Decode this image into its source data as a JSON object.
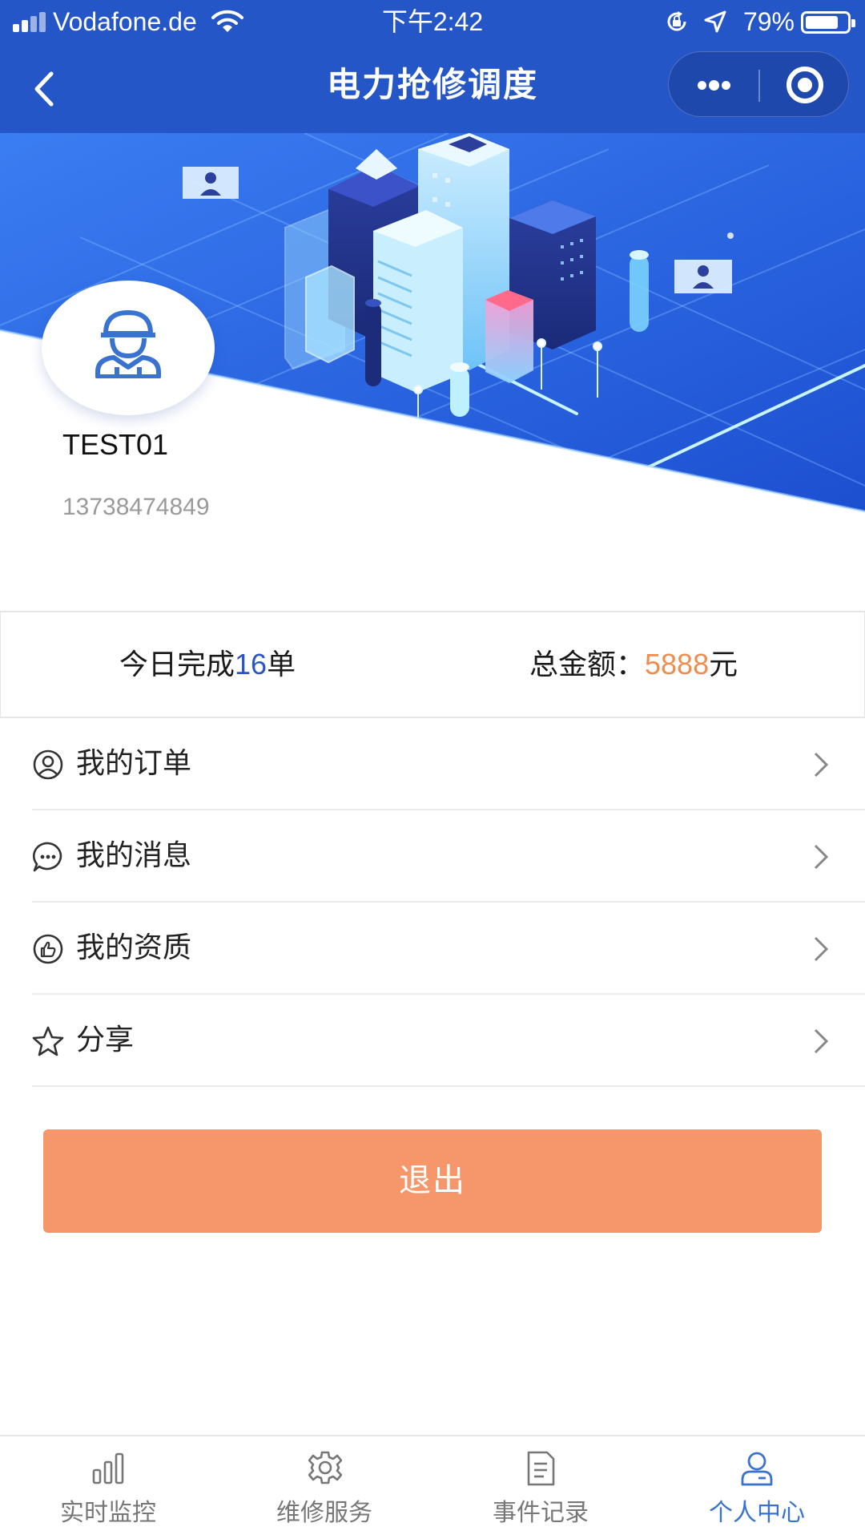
{
  "status_bar": {
    "carrier": "Vodafone.de",
    "time": "下午2:42",
    "battery_percent": "79%",
    "battery_level": 0.79
  },
  "nav": {
    "title": "电力抢修调度",
    "back_icon": "chevron-left-icon",
    "more_icon": "more-dots-icon",
    "close_icon": "target-circle-icon"
  },
  "profile": {
    "avatar_icon": "worker-helmet-icon",
    "name": "TEST01",
    "phone": "13738474849"
  },
  "stats": {
    "today_prefix": "今日完成",
    "today_count": "16",
    "today_suffix": "单",
    "total_prefix": "总金额：",
    "total_amount": "5888",
    "total_suffix": "元"
  },
  "menu": {
    "items": [
      {
        "label": "我的订单",
        "icon": "user-circle-icon"
      },
      {
        "label": "我的消息",
        "icon": "chat-bubble-icon"
      },
      {
        "label": "我的资质",
        "icon": "thumbs-up-icon"
      },
      {
        "label": "分享",
        "icon": "star-icon"
      }
    ]
  },
  "logout_label": "退出",
  "tabs": [
    {
      "label": "实时监控",
      "icon": "bar-chart-icon",
      "active": false
    },
    {
      "label": "维修服务",
      "icon": "gear-icon",
      "active": false
    },
    {
      "label": "事件记录",
      "icon": "document-icon",
      "active": false
    },
    {
      "label": "个人中心",
      "icon": "person-icon",
      "active": true
    }
  ],
  "colors": {
    "brand_blue": "#2456c8",
    "highlight_blue": "#2b55c2",
    "amount_orange": "#ef8d4e",
    "logout_orange": "#f5976b",
    "active_tab": "#3a73cf",
    "inactive_tab": "#777777"
  }
}
